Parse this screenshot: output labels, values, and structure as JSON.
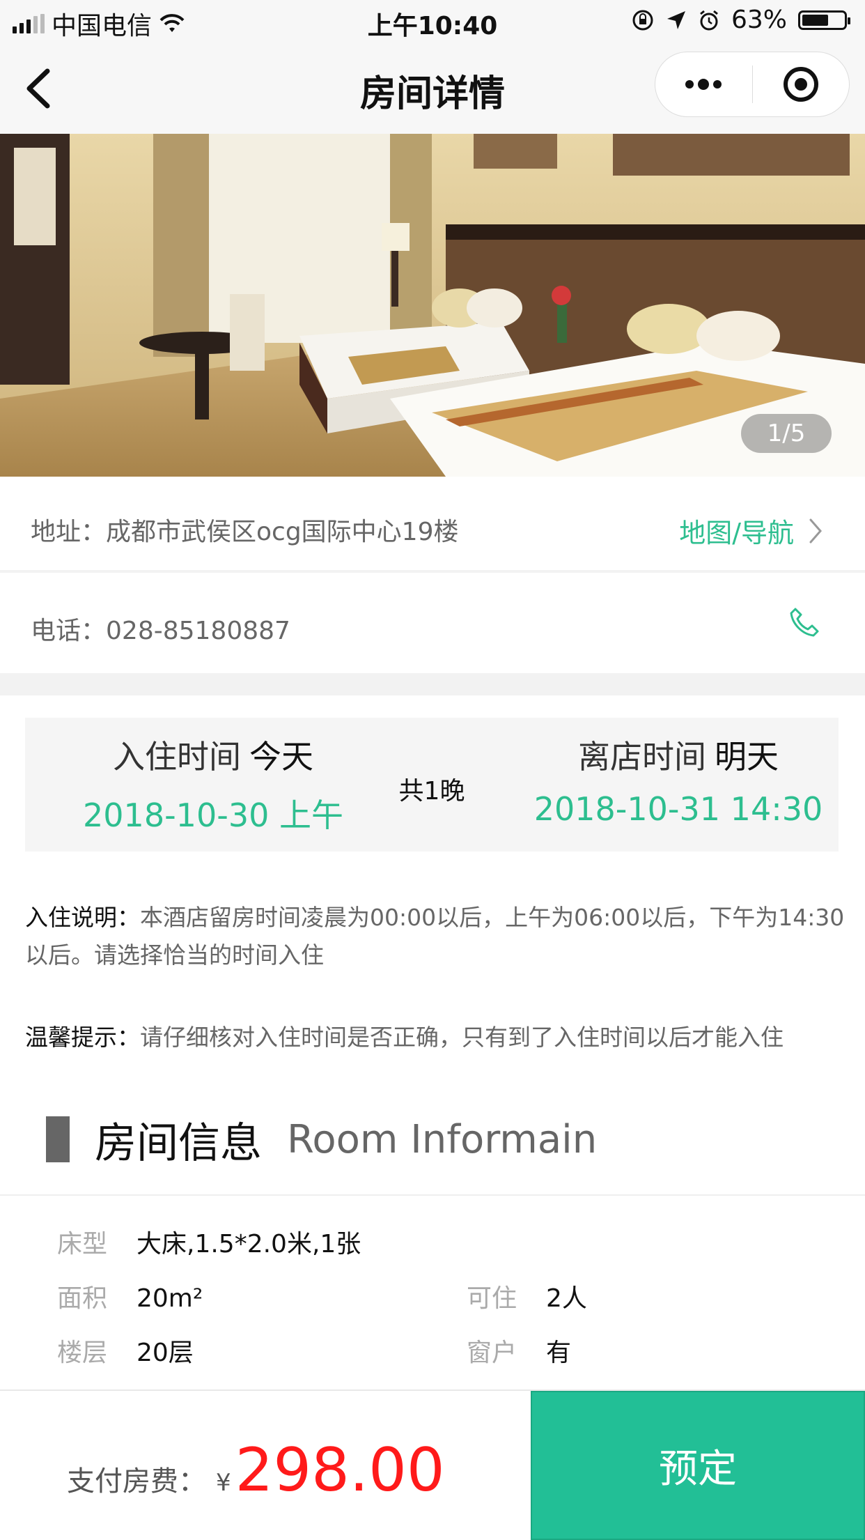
{
  "status_bar": {
    "carrier": "中国电信",
    "time": "上午10:40",
    "battery": "63%",
    "battery_level": 0.63
  },
  "nav": {
    "title": "房间详情"
  },
  "gallery": {
    "counter": "1/5"
  },
  "address": {
    "label": "地址：",
    "value": "成都市武侯区ocg国际中心19楼",
    "map_link": "地图/导航"
  },
  "phone": {
    "label": "电话：",
    "value": "028-85180887"
  },
  "stay": {
    "checkin_label": "入住时间",
    "checkin_day": "今天",
    "checkin_date": "2018-10-30 上午",
    "nights": "共1晚",
    "checkout_label": "离店时间",
    "checkout_day": "明天",
    "checkout_date": "2018-10-31 14:30"
  },
  "notes": {
    "checkin_key": "入住说明：",
    "checkin_text": "本酒店留房时间凌晨为00:00以后，上午为06:00以后，下午为14:30以后。请选择恰当的时间入住",
    "tip_key": "温馨提示：",
    "tip_text": "请仔细核对入住时间是否正确，只有到了入住时间以后才能入住"
  },
  "room_info": {
    "title_zh": "房间信息",
    "title_en": "Room Informain",
    "bed_key": "床型",
    "bed_val": "大床,1.5*2.0米,1张",
    "area_key": "面积",
    "area_val": "20m²",
    "capacity_key": "可住",
    "capacity_val": "2人",
    "floor_key": "楼层",
    "floor_val": "20层",
    "window_key": "窗户",
    "window_val": "有"
  },
  "footer": {
    "pay_label": "支付房费：",
    "currency": "¥",
    "amount": "298.00",
    "book_label": "预定"
  },
  "colors": {
    "accent_green": "#2dbe8f",
    "price_red": "#ff1a1a"
  }
}
